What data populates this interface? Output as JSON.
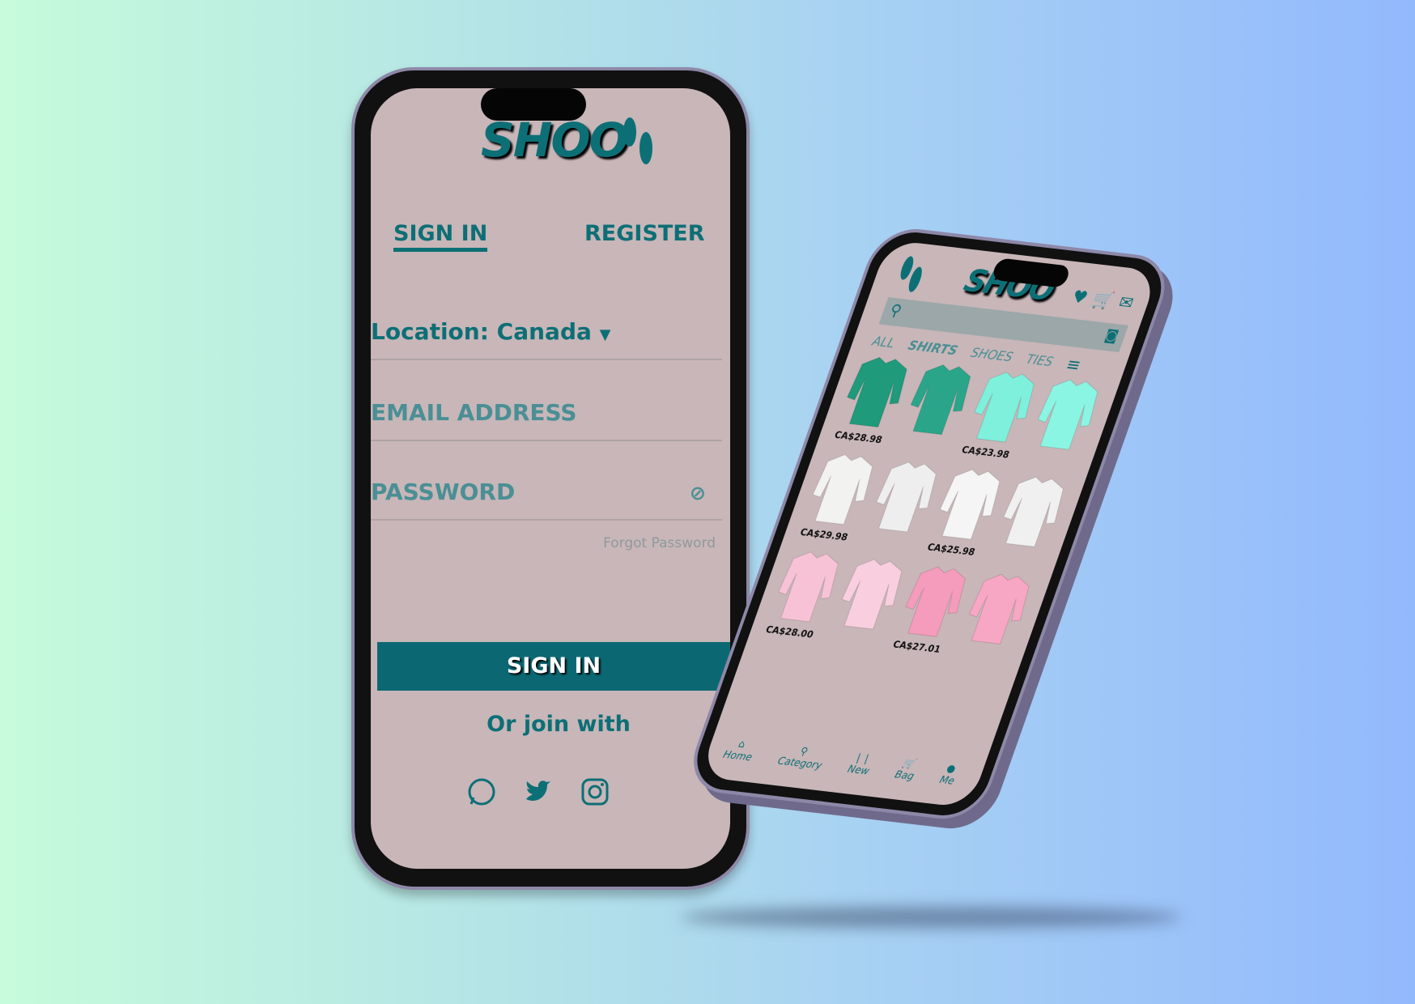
{
  "signin_screen": {
    "logo": "SHOO",
    "tabs": [
      {
        "label": "SIGN IN",
        "active": true
      },
      {
        "label": "REGISTER",
        "active": false
      }
    ],
    "location_label": "Location:",
    "location_value": "Canada",
    "email_placeholder": "EMAIL ADDRESS",
    "password_placeholder": "PASSWORD",
    "forgot_password": "Forgot Password",
    "signin_button": "SIGN IN",
    "join_with": "Or join with",
    "social": [
      "whatsapp-icon",
      "twitter-icon",
      "instagram-icon"
    ]
  },
  "shop_screen": {
    "logo": "SHOO",
    "categories": [
      {
        "label": "ALL"
      },
      {
        "label": "SHIRTS",
        "active": true
      },
      {
        "label": "SHOES"
      },
      {
        "label": "TIES"
      }
    ],
    "products": [
      {
        "color": "#1f9a7b",
        "color2": "#2aa58a",
        "price": "CA$28.98"
      },
      {
        "color": "#7ff0dc",
        "color2": "#8af5e2",
        "price": "CA$23.98"
      },
      {
        "color": "#f2f2f0",
        "color2": "#eeeeee",
        "price": "CA$29.98"
      },
      {
        "color": "#f5f5f5",
        "color2": "#f0f0f0",
        "price": "CA$25.98"
      },
      {
        "color": "#f7c2d6",
        "color2": "#f9cfe0",
        "price": "CA$28.00"
      },
      {
        "color": "#f59bbb",
        "color2": "#f7a6c3",
        "price": "CA$27.01"
      }
    ],
    "nav": [
      {
        "label": "Home",
        "icon": "⌂"
      },
      {
        "label": "Category",
        "icon": "⚲"
      },
      {
        "label": "New",
        "icon": "❘❘"
      },
      {
        "label": "Bag",
        "icon": "🛒"
      },
      {
        "label": "Me",
        "icon": "●"
      }
    ]
  },
  "colors": {
    "teal": "#0d6f76",
    "screen": "#c8b6b8"
  }
}
